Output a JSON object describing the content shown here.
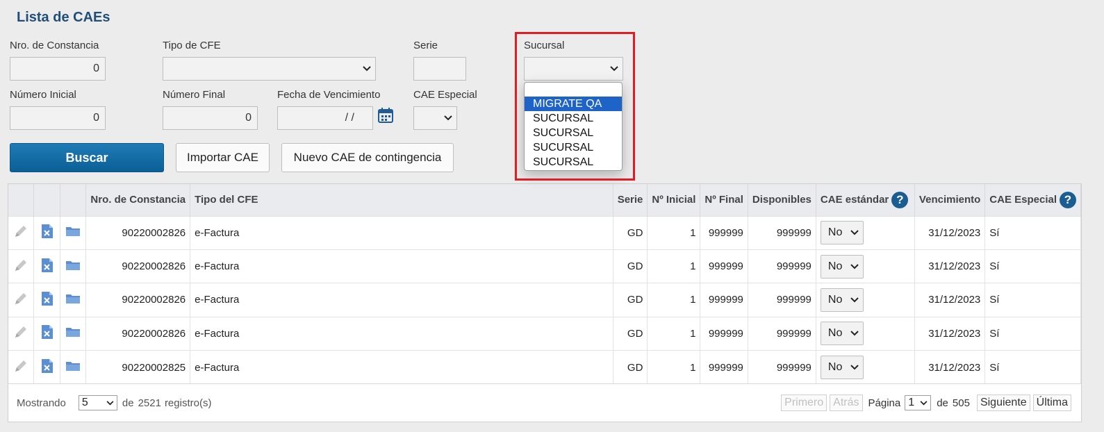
{
  "page": {
    "title": "Lista de CAEs"
  },
  "filters": {
    "nro_constancia": {
      "label": "Nro. de Constancia",
      "value": "0"
    },
    "tipo_cfe": {
      "label": "Tipo de CFE",
      "value": ""
    },
    "serie": {
      "label": "Serie",
      "value": ""
    },
    "sucursal": {
      "label": "Sucursal",
      "value": ""
    },
    "numero_inicial": {
      "label": "Número Inicial",
      "value": "0"
    },
    "numero_final": {
      "label": "Número Final",
      "value": "0"
    },
    "fecha_vencimiento": {
      "label": "Fecha de Vencimiento",
      "value": "/ /"
    },
    "cae_especial": {
      "label": "CAE Especial",
      "value": ""
    }
  },
  "sucursal_dropdown": {
    "options": [
      "",
      "MIGRATE QA",
      "SUCURSAL",
      "SUCURSAL",
      "SUCURSAL",
      "SUCURSAL"
    ],
    "selected_index": 1
  },
  "buttons": {
    "buscar": "Buscar",
    "importar": "Importar CAE",
    "nuevo": "Nuevo CAE de contingencia"
  },
  "table": {
    "headers": [
      "Nro. de Constancia",
      "Tipo del CFE",
      "Serie",
      "Nº Inicial",
      "Nº Final",
      "Disponibles",
      "CAE estándar",
      "Vencimiento",
      "CAE Especial"
    ],
    "rows": [
      {
        "nro": "90220002826",
        "tipo": "e-Factura",
        "serie": "GD",
        "inicial": "1",
        "final": "999999",
        "disp": "999999",
        "estandar": "No",
        "venc": "31/12/2023",
        "especial": "Sí"
      },
      {
        "nro": "90220002826",
        "tipo": "e-Factura",
        "serie": "GD",
        "inicial": "1",
        "final": "999999",
        "disp": "999999",
        "estandar": "No",
        "venc": "31/12/2023",
        "especial": "Sí"
      },
      {
        "nro": "90220002826",
        "tipo": "e-Factura",
        "serie": "GD",
        "inicial": "1",
        "final": "999999",
        "disp": "999999",
        "estandar": "No",
        "venc": "31/12/2023",
        "especial": "Sí"
      },
      {
        "nro": "90220002826",
        "tipo": "e-Factura",
        "serie": "GD",
        "inicial": "1",
        "final": "999999",
        "disp": "999999",
        "estandar": "No",
        "venc": "31/12/2023",
        "especial": "Sí"
      },
      {
        "nro": "90220002825",
        "tipo": "e-Factura",
        "serie": "GD",
        "inicial": "1",
        "final": "999999",
        "disp": "999999",
        "estandar": "No",
        "venc": "31/12/2023",
        "especial": "Sí"
      }
    ]
  },
  "footer": {
    "mostrando": "Mostrando",
    "page_size": "5",
    "de": "de",
    "total": "2521",
    "registros": "registro(s)",
    "primero": "Primero",
    "atras": "Atrás",
    "pagina": "Página",
    "page": "1",
    "de2": "de",
    "pages": "505",
    "siguiente": "Siguiente",
    "ultima": "Última"
  },
  "icons": [
    "pencil-icon",
    "excel-delete-icon",
    "folder-icon",
    "calendar-icon",
    "help-icon",
    "chevron-down-icon"
  ],
  "colors": {
    "accent": "#1f4e79",
    "primary_btn": "#0b5f96",
    "highlight": "#e01c24",
    "selection": "#1e64c8"
  }
}
